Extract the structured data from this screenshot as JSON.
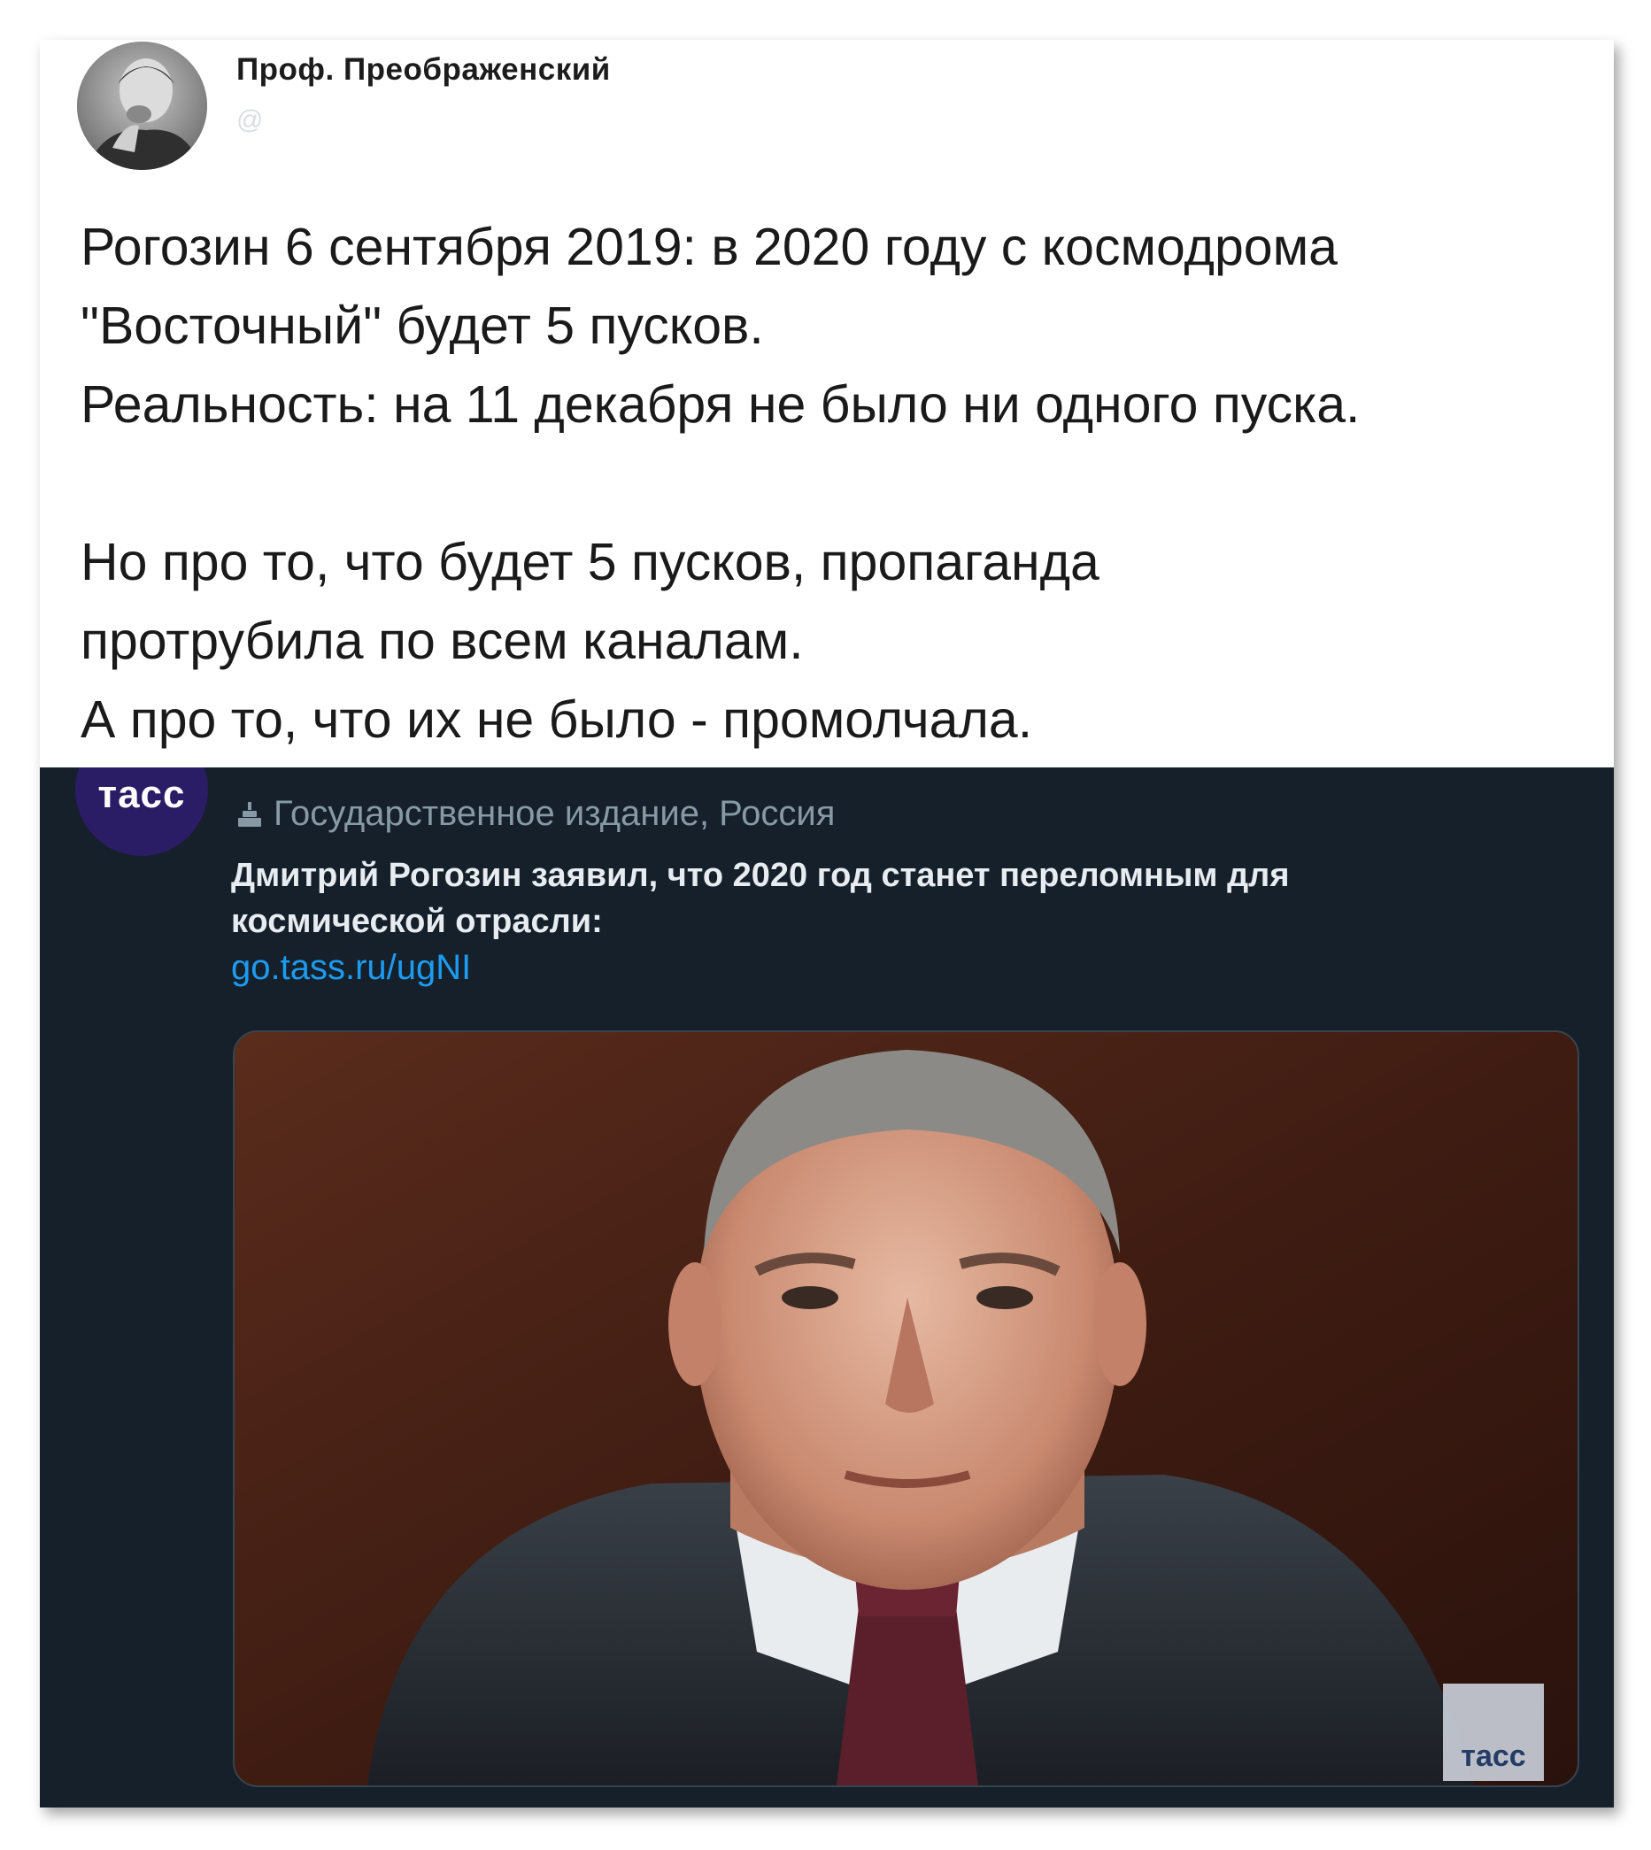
{
  "top_tweet": {
    "author": "Проф. Преображенский",
    "handle": "@",
    "lines": [
      "Рогозин 6 сентября 2019: в 2020 году с космодрома",
      "\"Восточный\" будет 5 пусков.",
      "Реальность: на 11 декабря не было ни одного пуска.",
      "",
      "Но про то, что будет 5 пусков, пропаганда",
      "протрубила по всем каналам.",
      "А про то, что их не было - промолчала."
    ]
  },
  "embedded_tweet": {
    "avatar_text": "тасс",
    "state_label": "Государственное издание, Россия",
    "text": "Дмитрий Рогозин заявил, что 2020 год станет переломным для космической отрасли:",
    "link": "go.tass.ru/ugNI",
    "watermark": "тасс"
  },
  "colors": {
    "dark_background": "#15202b",
    "link": "#1d9bf0",
    "tass_avatar": "#2b1c66"
  }
}
